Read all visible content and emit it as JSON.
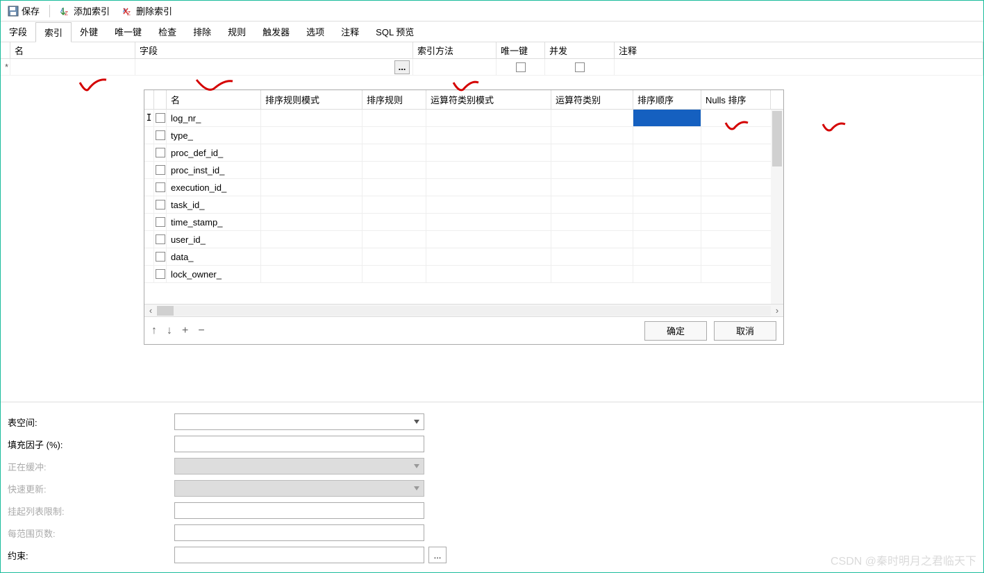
{
  "toolbar": {
    "save": "保存",
    "add_index": "添加索引",
    "delete_index": "删除索引"
  },
  "tabs": [
    "字段",
    "索引",
    "外键",
    "唯一键",
    "检查",
    "排除",
    "规则",
    "触发器",
    "选项",
    "注释",
    "SQL 预览"
  ],
  "grid_headers": {
    "name": "名",
    "fields": "字段",
    "method": "索引方法",
    "unique": "唯一键",
    "concurrent": "并发",
    "comment": "注释"
  },
  "dialog_headers": {
    "name": "名",
    "coll_schema": "排序规则模式",
    "coll": "排序规则",
    "op_schema": "运算符类别模式",
    "op": "运算符类别",
    "order": "排序顺序",
    "nulls": "Nulls 排序"
  },
  "fields": [
    "log_nr_",
    "type_",
    "proc_def_id_",
    "proc_inst_id_",
    "execution_id_",
    "task_id_",
    "time_stamp_",
    "user_id_",
    "data_",
    "lock_owner_"
  ],
  "dialog_buttons": {
    "ok": "确定",
    "cancel": "取消"
  },
  "footer_tools": {
    "up": "↑",
    "down": "↓",
    "add": "+",
    "remove": "−"
  },
  "properties": {
    "tablespace": "表空间:",
    "fillfactor": "填充因子 (%):",
    "buffering": "正在缓冲:",
    "fastupdate": "快速更新:",
    "pending": "挂起列表限制:",
    "pages": "每范围页数:",
    "constraint": "约束:"
  },
  "ellipsis": "...",
  "asterisk": "*",
  "watermark": "CSDN @秦时明月之君临天下"
}
